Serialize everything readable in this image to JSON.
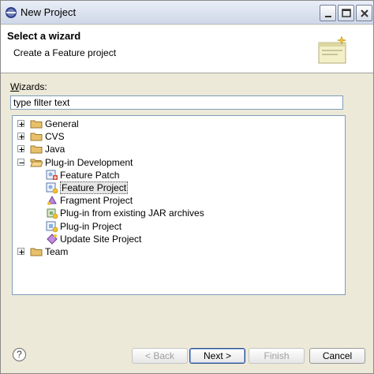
{
  "window": {
    "title": "New Project"
  },
  "banner": {
    "title": "Select a wizard",
    "description": "Create a Feature project"
  },
  "wizards": {
    "label_prefix": "W",
    "label_rest": "izards:",
    "filter_value": "type filter text"
  },
  "tree": {
    "items": [
      {
        "label": "General",
        "icon": "folder-icon",
        "expander": "plus"
      },
      {
        "label": "CVS",
        "icon": "folder-icon",
        "expander": "plus"
      },
      {
        "label": "Java",
        "icon": "folder-icon",
        "expander": "plus"
      },
      {
        "label": "Plug-in Development",
        "icon": "folder-open-icon",
        "expander": "minus"
      },
      {
        "label": "Feature Patch",
        "icon": "feature-patch-icon"
      },
      {
        "label": "Feature Project",
        "icon": "feature-project-icon",
        "selected": true
      },
      {
        "label": "Fragment Project",
        "icon": "fragment-project-icon"
      },
      {
        "label": "Plug-in from existing JAR archives",
        "icon": "plugin-jar-icon"
      },
      {
        "label": "Plug-in Project",
        "icon": "plugin-project-icon"
      },
      {
        "label": "Update Site Project",
        "icon": "update-site-icon"
      },
      {
        "label": "Team",
        "icon": "folder-icon",
        "expander": "plus"
      }
    ]
  },
  "buttons": {
    "help": "?",
    "back": "< Back",
    "next": "Next >",
    "finish": "Finish",
    "cancel": "Cancel"
  },
  "colors": {
    "accent": "#2f4f86",
    "folder": "#e8c06a",
    "selection": "#e6e6e6"
  }
}
